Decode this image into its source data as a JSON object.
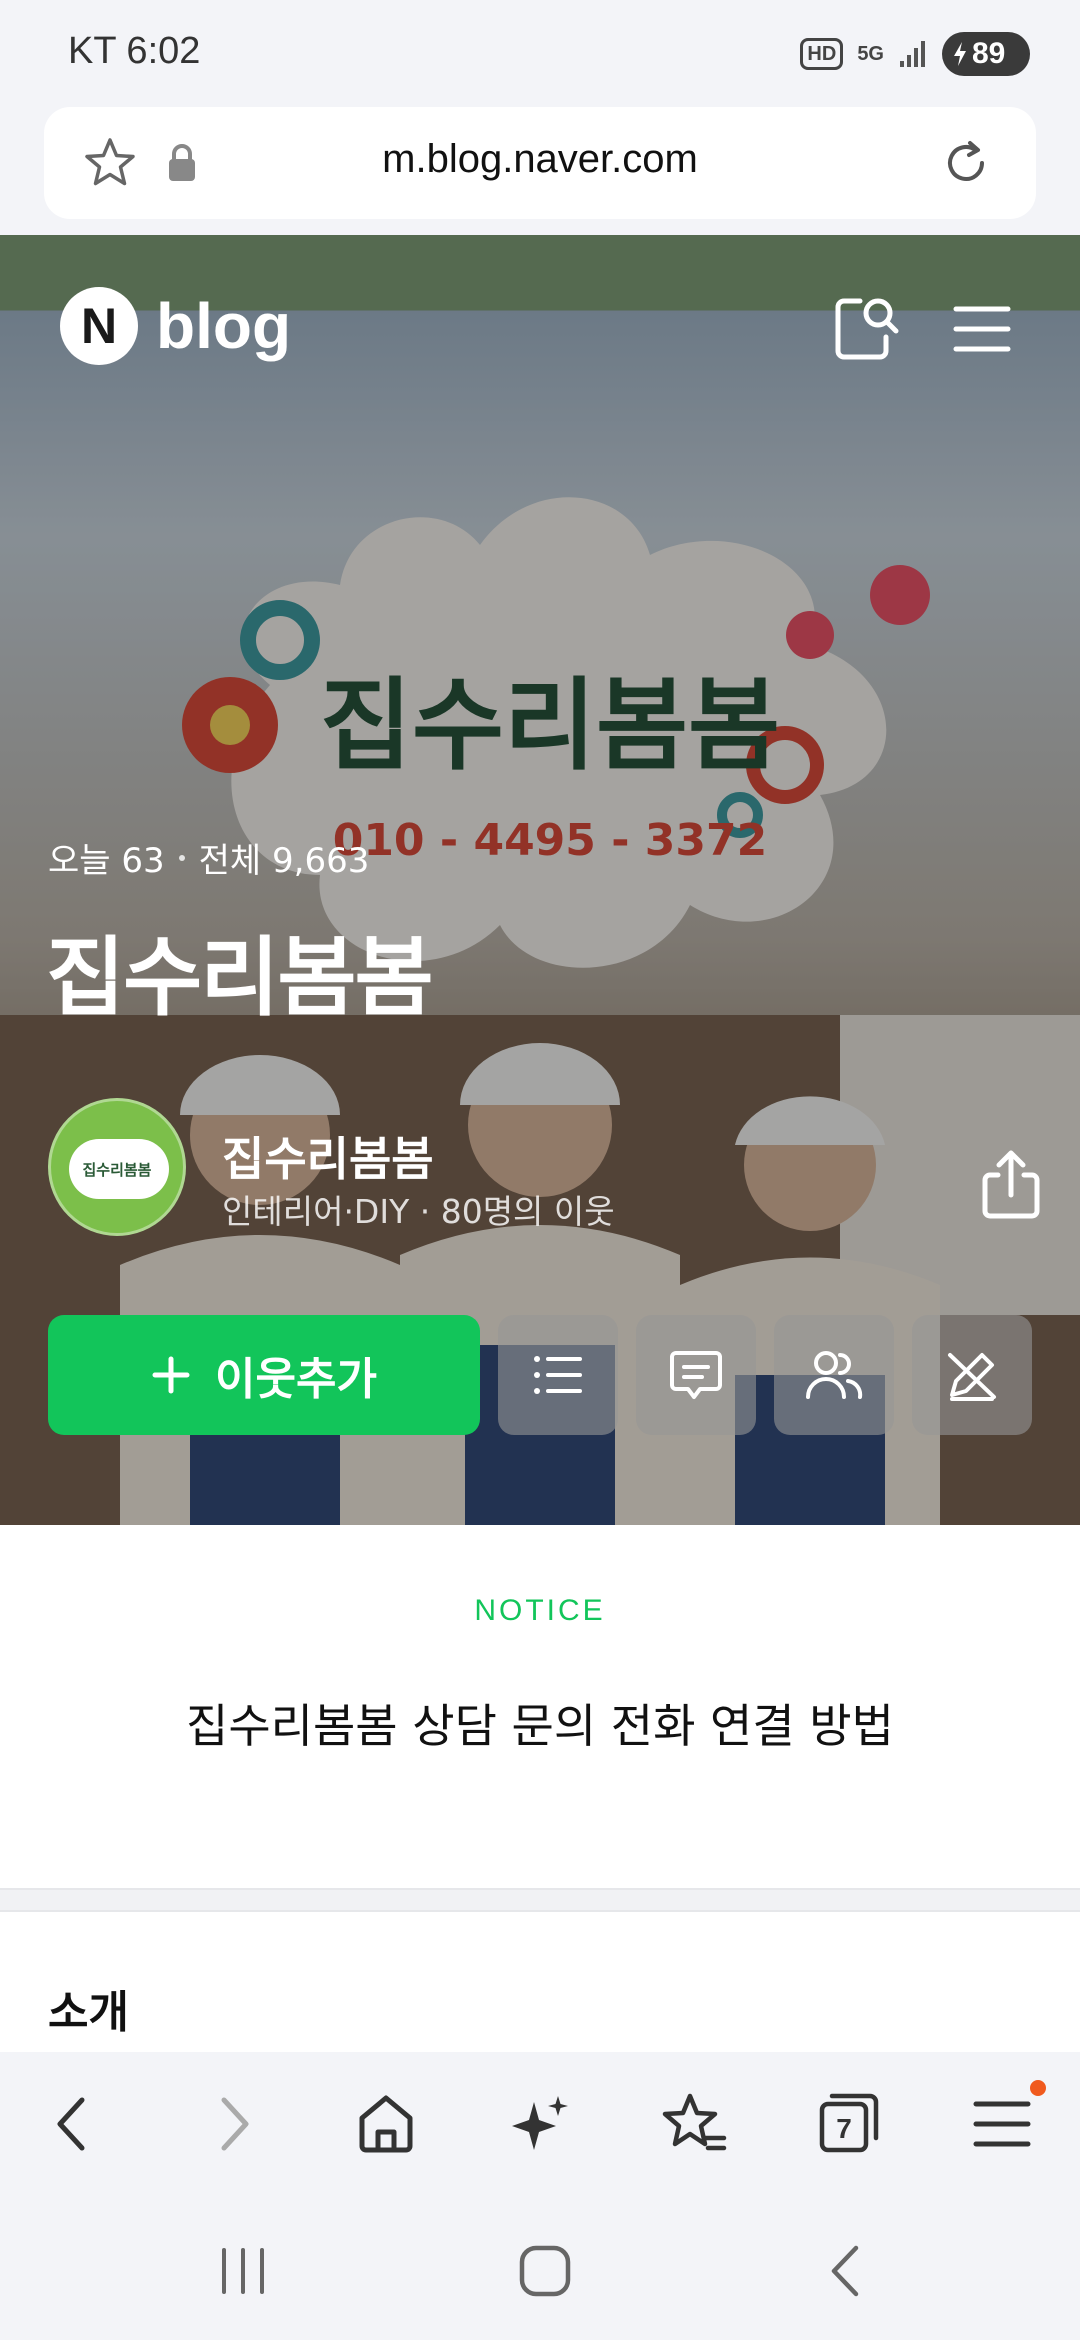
{
  "status_bar": {
    "carrier_time": "KT 6:02",
    "hd_badge": "HD",
    "network": "5G",
    "battery": "89"
  },
  "address_bar": {
    "url": "m.blog.naver.com"
  },
  "blog_header": {
    "logo_letter": "N",
    "logo_text": "blog"
  },
  "banner": {
    "sign_title": "집수리봄봄",
    "sign_phone": "010 - 4495 - 3372"
  },
  "hero": {
    "today_visits": "오늘 63",
    "total_visits": "전체 9,663",
    "blog_title": "집수리봄봄",
    "avatar_text": "집수리봄봄",
    "owner_name": "집수리봄봄",
    "owner_meta": "인테리어·DIY · 80명의 이웃",
    "add_neighbor_label": "이웃추가"
  },
  "notice": {
    "label": "NOTICE",
    "title": "집수리봄봄 상담 문의 전화 연결 방법"
  },
  "intro": {
    "title": "소개"
  },
  "toolbar": {
    "tabs_count": "7"
  },
  "colors": {
    "accent_green": "#12c55a",
    "notification_dot": "#f05a1e"
  },
  "icons": [
    "star-icon",
    "lock-icon",
    "reload-icon",
    "search-icon",
    "menu-icon",
    "share-icon",
    "list-icon",
    "chat-icon",
    "neighbors-icon",
    "no-edit-icon",
    "back-icon",
    "forward-icon",
    "home-icon",
    "sparkle-icon",
    "bookmarks-icon",
    "tabs-icon"
  ]
}
